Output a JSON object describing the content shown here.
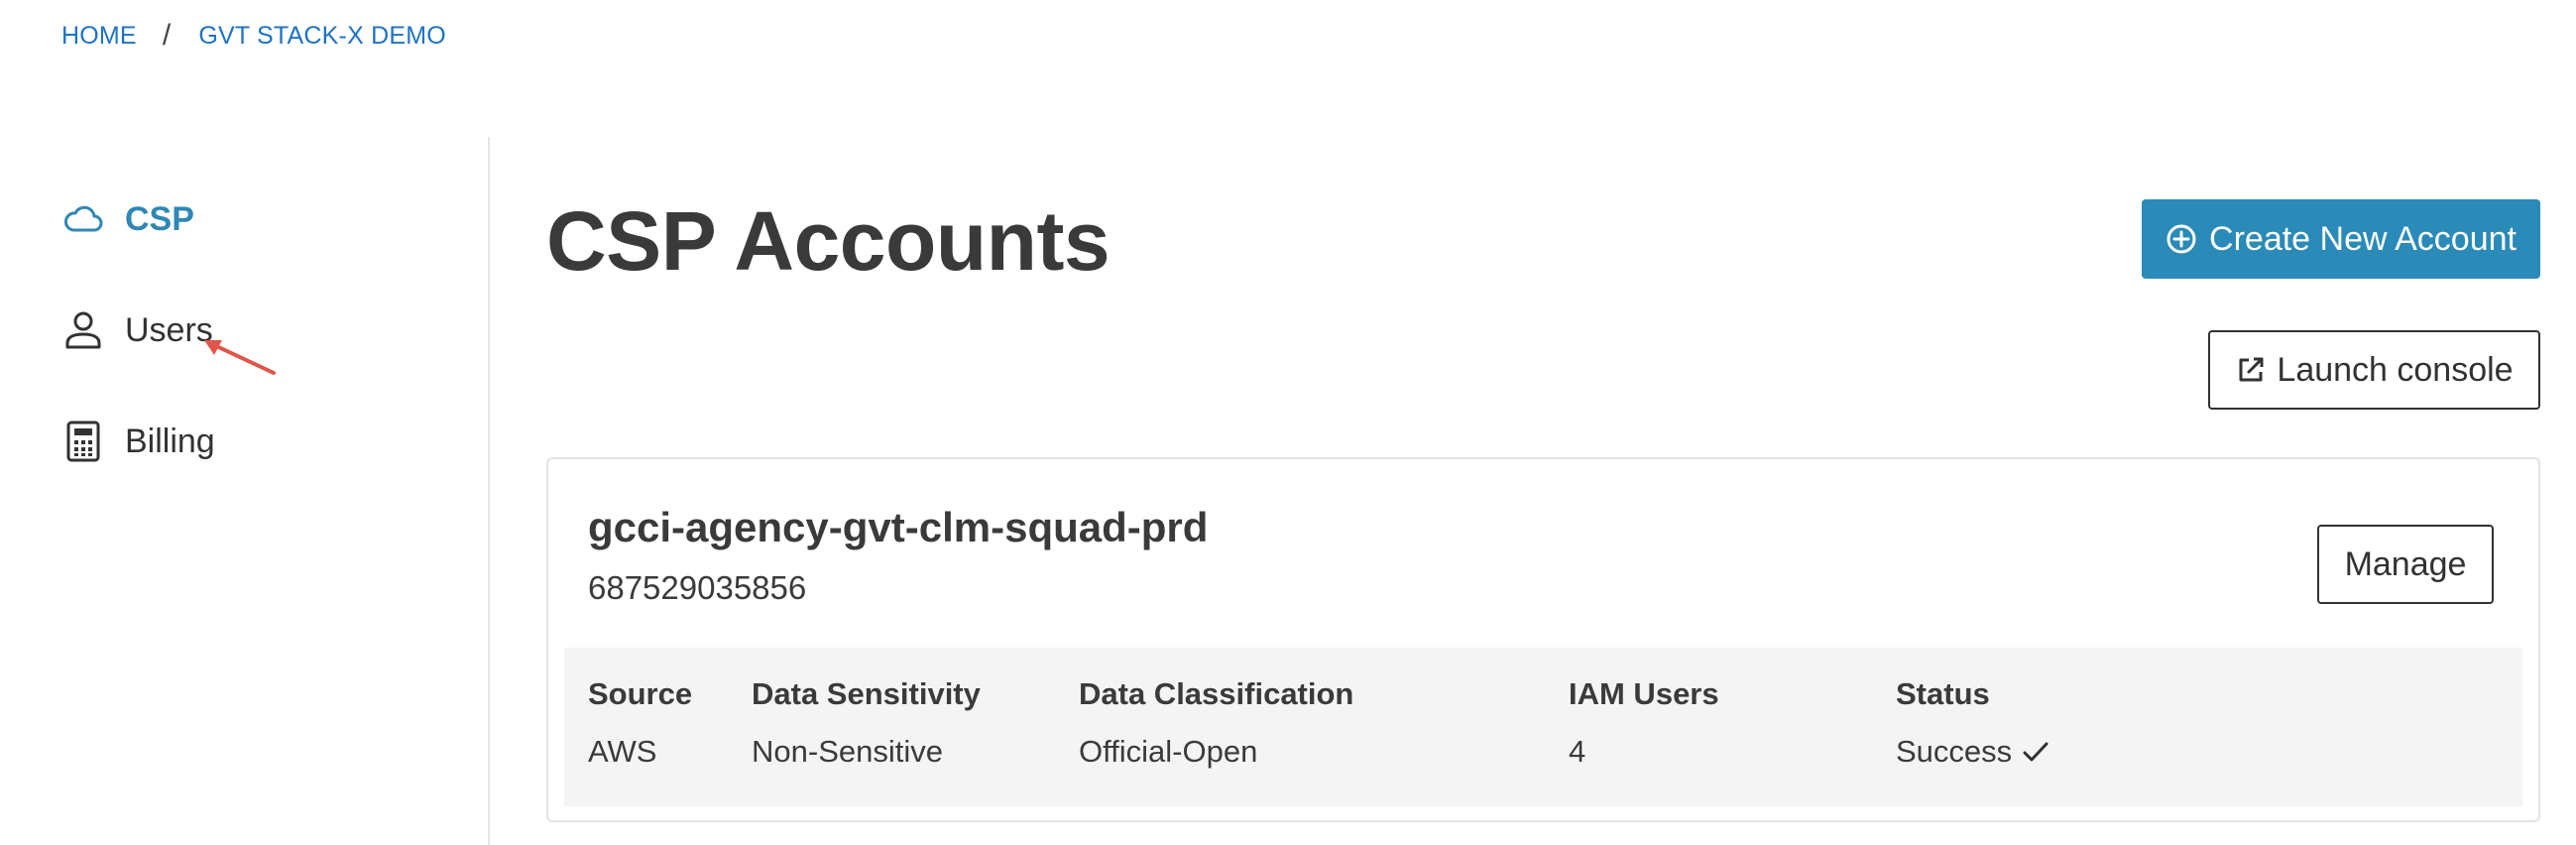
{
  "breadcrumb": {
    "home": "HOME",
    "separator": "/",
    "current": "GVT STACK-X DEMO"
  },
  "sidebar": {
    "items": [
      {
        "label": "CSP",
        "icon": "cloud-icon",
        "active": true
      },
      {
        "label": "Users",
        "icon": "user-icon",
        "active": false
      },
      {
        "label": "Billing",
        "icon": "calculator-icon",
        "active": false
      }
    ]
  },
  "main": {
    "title": "CSP Accounts",
    "create_button": "Create New Account",
    "launch_button": "Launch console"
  },
  "account": {
    "name": "gcci-agency-gvt-clm-squad-prd",
    "id": "687529035856",
    "manage_button": "Manage",
    "columns": [
      {
        "header": "Source",
        "value": "AWS"
      },
      {
        "header": "Data Sensitivity",
        "value": "Non-Sensitive"
      },
      {
        "header": "Data Classification",
        "value": "Official-Open"
      },
      {
        "header": "IAM Users",
        "value": "4"
      },
      {
        "header": "Status",
        "value": "Success"
      }
    ]
  },
  "colors": {
    "link": "#1d72c4",
    "accent": "#2a8ab8",
    "active_nav": "#2e87b4",
    "cursor_arrow": "#e0564a",
    "details_background": "#f4f4f4"
  }
}
